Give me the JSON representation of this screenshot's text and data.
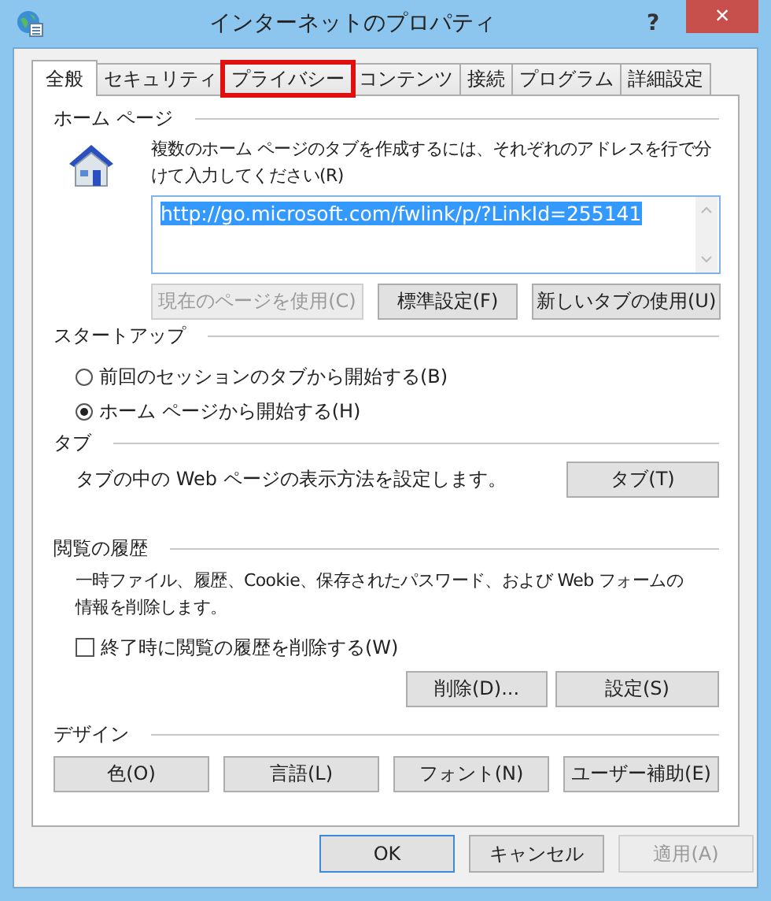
{
  "window": {
    "title": "インターネットのプロパティ",
    "help": "?",
    "close": "×"
  },
  "tabs": [
    {
      "label": "全般",
      "selected": true,
      "highlighted": false
    },
    {
      "label": "セキュリティ",
      "selected": false,
      "highlighted": false
    },
    {
      "label": "プライバシー",
      "selected": false,
      "highlighted": true
    },
    {
      "label": "コンテンツ",
      "selected": false,
      "highlighted": false
    },
    {
      "label": "接続",
      "selected": false,
      "highlighted": false
    },
    {
      "label": "プログラム",
      "selected": false,
      "highlighted": false
    },
    {
      "label": "詳細設定",
      "selected": false,
      "highlighted": false
    }
  ],
  "home_page": {
    "heading": "ホーム ページ",
    "description": "複数のホーム ページのタブを作成するには、それぞれのアドレスを行で分けて入力してください(R)",
    "value": "http://go.microsoft.com/fwlink/p/?LinkId=255141",
    "value_selected": true,
    "buttons": [
      {
        "label": "現在のページを使用(C)",
        "disabled": true
      },
      {
        "label": "標準設定(F)",
        "disabled": false
      },
      {
        "label": "新しいタブの使用(U)",
        "disabled": false
      }
    ]
  },
  "startup": {
    "heading": "スタートアップ",
    "options": [
      {
        "label": "前回のセッションのタブから開始する(B)",
        "selected": false
      },
      {
        "label": "ホーム ページから開始する(H)",
        "selected": true
      }
    ]
  },
  "tab_settings": {
    "heading": "タブ",
    "description": "タブの中の Web ページの表示方法を設定します。",
    "button": "タブ(T)"
  },
  "history": {
    "heading": "閲覧の履歴",
    "description": "一時ファイル、履歴、Cookie、保存されたパスワード、および Web フォームの情報を削除します。",
    "checkbox": {
      "label": "終了時に閲覧の履歴を削除する(W)",
      "checked": false
    },
    "buttons": [
      "削除(D)...",
      "設定(S)"
    ]
  },
  "design": {
    "heading": "デザイン",
    "buttons": [
      "色(O)",
      "言語(L)",
      "フォント(N)",
      "ユーザー補助(E)"
    ]
  },
  "footer_buttons": [
    {
      "label": "OK",
      "default": true,
      "disabled": false
    },
    {
      "label": "キャンセル",
      "default": false,
      "disabled": false
    },
    {
      "label": "適用(A)",
      "default": false,
      "disabled": true
    }
  ]
}
